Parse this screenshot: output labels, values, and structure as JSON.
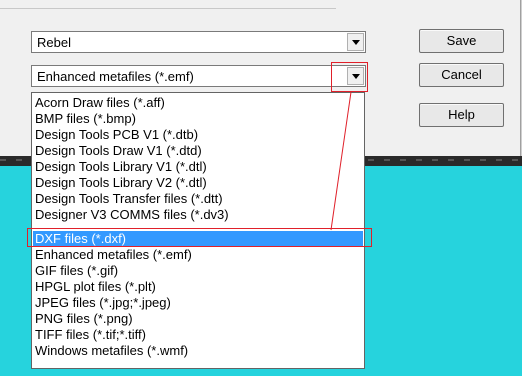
{
  "combo_top": {
    "value": "Rebel"
  },
  "combo_format": {
    "value": "Enhanced metafiles (*.emf)"
  },
  "buttons": {
    "save": "Save",
    "cancel": "Cancel",
    "help": "Help"
  },
  "file_types": [
    "Acorn Draw files (*.aff)",
    "BMP files (*.bmp)",
    "Design Tools PCB V1 (*.dtb)",
    "Design Tools Draw V1 (*.dtd)",
    "Design Tools Library V1 (*.dtl)",
    "Design Tools Library V2 (*.dtl)",
    "Design Tools Transfer files (*.dtt)",
    "Designer V3 COMMS files (*.dv3)",
    "DXF files (*.dxf)",
    "Enhanced metafiles (*.emf)",
    "GIF files (*.gif)",
    "HPGL plot files (*.plt)",
    "JPEG files (*.jpg;*.jpeg)",
    "PNG files (*.png)",
    "TIFF files (*.tif;*.tiff)",
    "Windows metafiles (*.wmf)"
  ],
  "selected_file_type": "DXF files (*.dxf)",
  "colors": {
    "selection": "#3399ff",
    "annotation": "#e0202a",
    "backdrop": "#26d3dd"
  },
  "icons": {
    "dropdown_arrow": "chevron-down-icon"
  }
}
